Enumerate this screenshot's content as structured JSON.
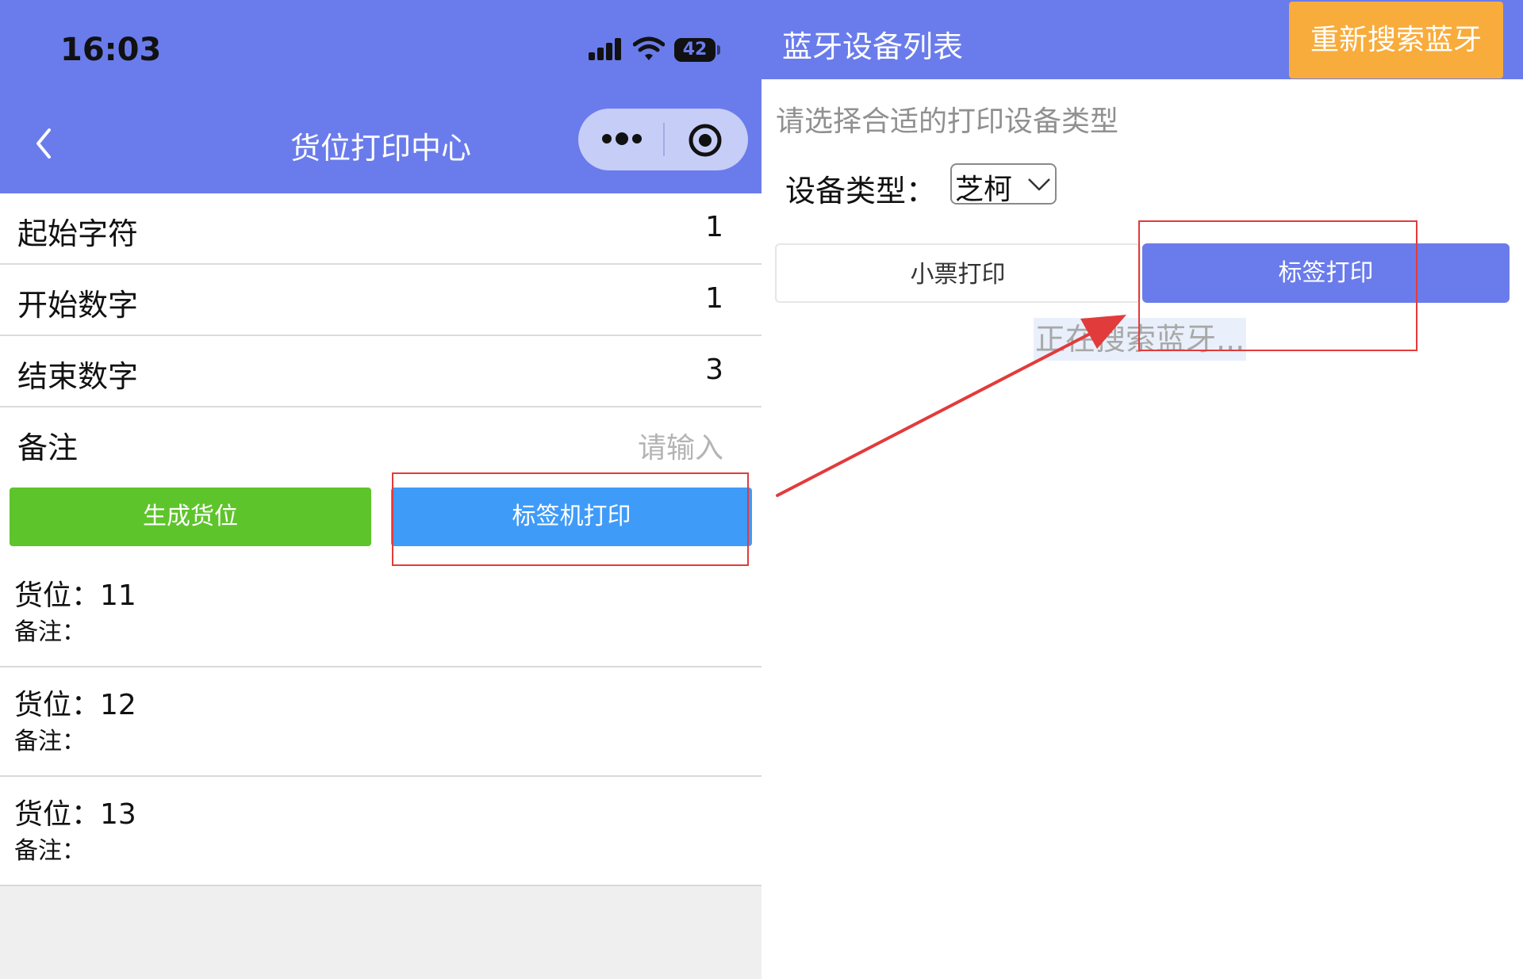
{
  "left": {
    "status_bar": {
      "time": "16:03",
      "battery": "42"
    },
    "nav": {
      "title": "货位打印中心"
    },
    "form": [
      {
        "label": "起始字符",
        "value": "1"
      },
      {
        "label": "开始数字",
        "value": "1"
      },
      {
        "label": "结束数字",
        "value": "3"
      },
      {
        "label": "备注",
        "placeholder": "请输入"
      }
    ],
    "buttons": {
      "generate": "生成货位",
      "label_print": "标签机打印"
    },
    "locations": [
      {
        "title": "货位：11",
        "note": "备注："
      },
      {
        "title": "货位：12",
        "note": "备注："
      },
      {
        "title": "货位：13",
        "note": "备注："
      }
    ],
    "colors": {
      "header": "#6a7ceb",
      "generate": "#5ec42b",
      "label_print": "#3f9bf8"
    }
  },
  "right": {
    "header": {
      "title": "蓝牙设备列表",
      "rescan": "重新搜索蓝牙"
    },
    "hint": "请选择合适的打印设备类型",
    "device_type": {
      "label": "设备类型：",
      "selected": "芝柯"
    },
    "tabs": {
      "receipt": "小票打印",
      "label": "标签打印"
    },
    "status": "正在搜索蓝牙...",
    "colors": {
      "rescan": "#f8ac3c",
      "tab_active": "#6a7ceb"
    }
  },
  "annotation": {
    "highlight_color": "#e23b3b"
  }
}
